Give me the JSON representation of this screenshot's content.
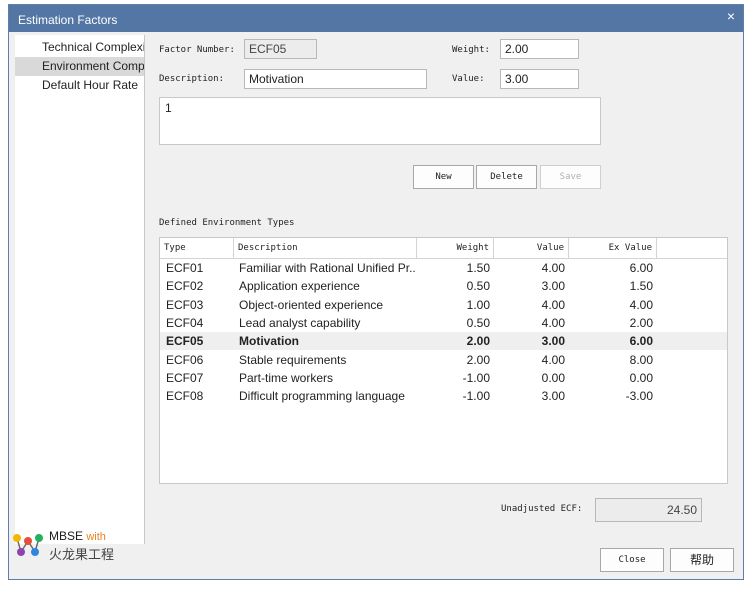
{
  "window": {
    "title": "Estimation Factors",
    "close_glyph": "×"
  },
  "nav": {
    "items": [
      {
        "label": "Technical Complexity"
      },
      {
        "label": "Environment Complexity"
      },
      {
        "label": "Default Hour Rate"
      }
    ],
    "selected": 1
  },
  "form": {
    "factor_number_label": "Factor Number:",
    "factor_number_value": "ECF05",
    "weight_label": "Weight:",
    "weight_value": "2.00",
    "description_label": "Description:",
    "description_value": "Motivation",
    "value_label": "Value:",
    "value_value": "3.00",
    "notes_value": "1"
  },
  "buttons": {
    "new": "New",
    "delete": "Delete",
    "save": "Save",
    "close": "Close",
    "help": "帮助"
  },
  "table": {
    "title": "Defined Environment Types",
    "columns": [
      "Type",
      "Description",
      "Weight",
      "Value",
      "Ex Value"
    ],
    "rows": [
      {
        "type": "ECF01",
        "description": "Familiar with Rational Unified Pr...",
        "weight": "1.50",
        "value": "4.00",
        "ex_value": "6.00"
      },
      {
        "type": "ECF02",
        "description": "Application experience",
        "weight": "0.50",
        "value": "3.00",
        "ex_value": "1.50"
      },
      {
        "type": "ECF03",
        "description": "Object-oriented experience",
        "weight": "1.00",
        "value": "4.00",
        "ex_value": "4.00"
      },
      {
        "type": "ECF04",
        "description": "Lead analyst capability",
        "weight": "0.50",
        "value": "4.00",
        "ex_value": "2.00"
      },
      {
        "type": "ECF05",
        "description": "Motivation",
        "weight": "2.00",
        "value": "3.00",
        "ex_value": "6.00"
      },
      {
        "type": "ECF06",
        "description": "Stable requirements",
        "weight": "2.00",
        "value": "4.00",
        "ex_value": "8.00"
      },
      {
        "type": "ECF07",
        "description": "Part-time workers",
        "weight": "-1.00",
        "value": "0.00",
        "ex_value": "0.00"
      },
      {
        "type": "ECF08",
        "description": "Difficult programming language",
        "weight": "-1.00",
        "value": "3.00",
        "ex_value": "-3.00"
      }
    ],
    "selected_row": 4
  },
  "summary": {
    "label": "Unadjusted ECF:",
    "value": "24.50"
  },
  "logo": {
    "line1": "MBSE",
    "line1_suffix": "with",
    "line2": "火龙果工程"
  },
  "colors": {
    "titlebar": "#5476a4",
    "selection": "#efefef",
    "logo_accent": "#e8821e"
  }
}
